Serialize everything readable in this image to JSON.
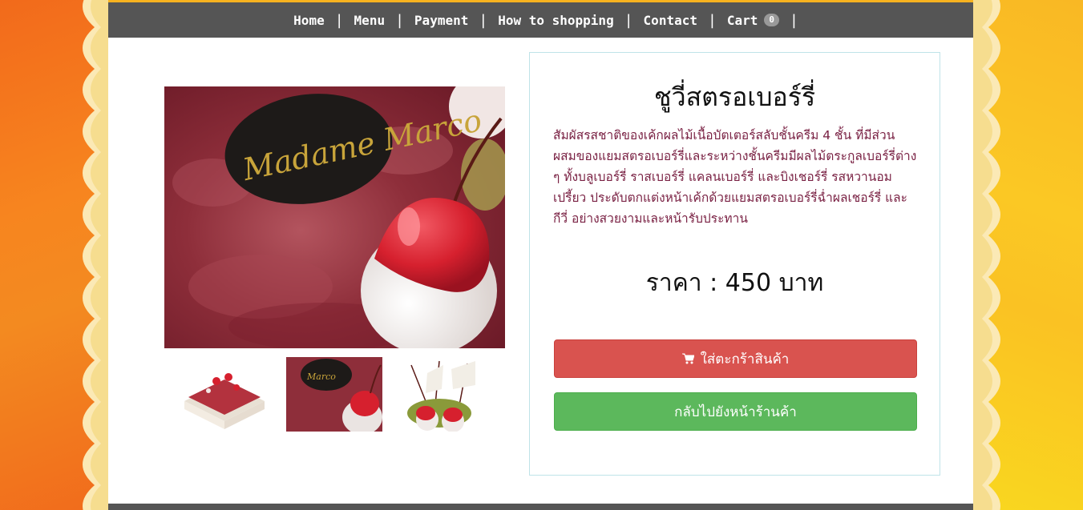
{
  "nav": {
    "items": [
      {
        "label": "Home"
      },
      {
        "label": "Menu"
      },
      {
        "label": "Payment"
      },
      {
        "label": "How to shopping"
      },
      {
        "label": "Contact"
      },
      {
        "label": "Cart"
      }
    ],
    "separator": "|",
    "cart_count": "0"
  },
  "product": {
    "image_label": "Madame Marco",
    "title": "ชูวี่สตรอเบอร์รี่",
    "description": "สัมผัสรสชาติของเค้กผลไม้เนื้อบัตเตอร์สลับชั้นครีม 4 ชั้น ที่มีส่วนผสมของแยมสตรอเบอร์รี่และระหว่างชั้นครีมมีผลไม้ตระกูลเบอร์รี่ต่าง ๆ ทั้งบลูเบอร์รี่ ราสเบอร์รี่ แคลนเบอร์รี่ และบิงเชอร์รี่ รสหวานอมเปรี้ยว ประดับตกแต่งหน้าเค้กด้วยแยมสตรอเบอร์รี่ฉ่ำผลเชอร์รี่ และกีวี่ อย่างสวยงามและหน้ารับประทาน",
    "price": "ราคา : 450 บาท"
  },
  "buttons": {
    "add_to_cart": "ใส่ตะกร้าสินค้า",
    "back_to_shop": "กลับไปยังหน้าร้านค้า"
  },
  "icons": {
    "cart": "shopping-cart-icon"
  },
  "colors": {
    "nav_bg": "#555555",
    "danger": "#d9534f",
    "success": "#5cb85c",
    "description_text": "#7a2244"
  }
}
